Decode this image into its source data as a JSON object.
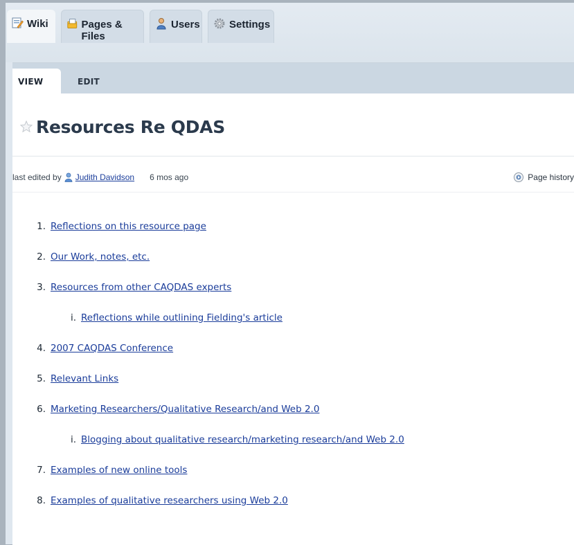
{
  "tabs": [
    {
      "label": "Wiki",
      "icon": "wiki-page-icon"
    },
    {
      "label": "Pages & Files",
      "icon": "pages-files-icon"
    },
    {
      "label": "Users",
      "icon": "users-icon"
    },
    {
      "label": "Settings",
      "icon": "settings-gear-icon"
    }
  ],
  "subtabs": {
    "view": "VIEW",
    "edit": "EDIT"
  },
  "page": {
    "title": "Resources Re QDAS",
    "last_edited_prefix": "last edited by",
    "editor": "Judith Davidson",
    "edited_ago": "6 mos ago",
    "history_label": "Page history"
  },
  "toc": [
    {
      "num": "1.",
      "text": "Reflections on this resource page"
    },
    {
      "num": "2.",
      "text": "Our Work, notes, etc."
    },
    {
      "num": "3.",
      "text": "Resources from other CAQDAS experts"
    },
    {
      "num": "i.",
      "text": "Reflections while outlining Fielding's article"
    },
    {
      "num": "4.",
      "text": "2007 CAQDAS Conference"
    },
    {
      "num": "5.",
      "text": "Relevant Links"
    },
    {
      "num": "6.",
      "text": "Marketing Researchers/Qualitative Research/and Web 2.0"
    },
    {
      "num": "i.",
      "text": "Blogging about qualitative research/marketing research/and Web 2.0"
    },
    {
      "num": "7.",
      "text": "Examples of new online tools"
    },
    {
      "num": "8.",
      "text": "Examples of qualitative researchers using Web 2.0"
    }
  ],
  "colors": {
    "link": "#1a3c9a",
    "title": "#2b3a4c",
    "nav_bg": "#cbd7e2"
  }
}
